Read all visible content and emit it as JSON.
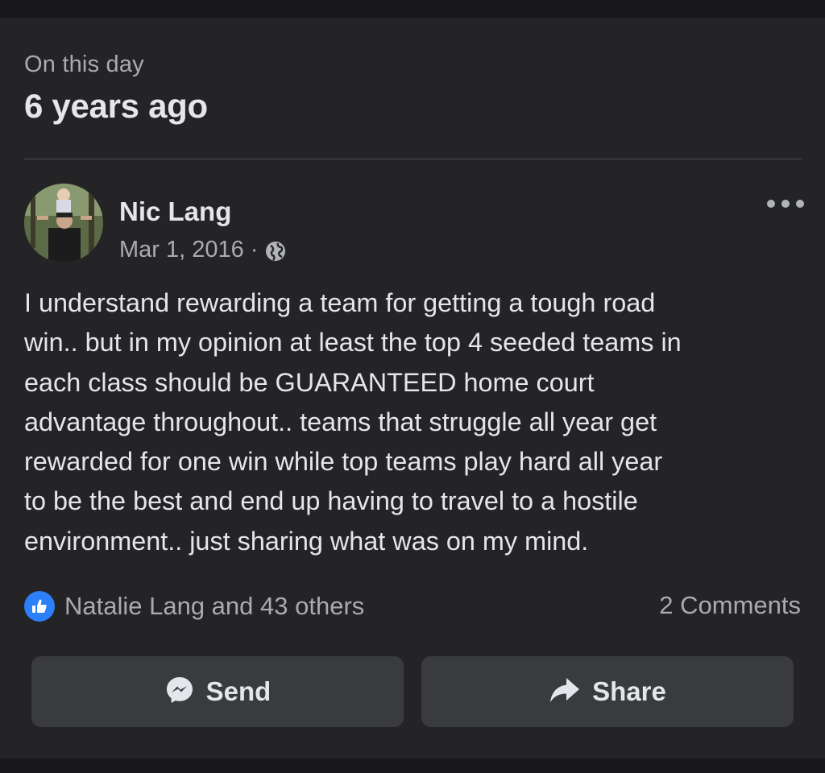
{
  "memory": {
    "label": "On this day",
    "title": "6 years ago"
  },
  "post": {
    "author": "Nic Lang",
    "date": "Mar 1, 2016",
    "separator": "·",
    "audience_icon": "globe-icon",
    "body": "I understand rewarding a team for getting a tough road\nwin.. but in my opinion at least the top 4 seeded teams in\neach class should be GUARANTEED home court\nadvantage throughout.. teams that struggle all year get\nrewarded for one win while top teams play hard all year\nto be the best and end up having to travel to a hostile\nenvironment.. just sharing what was on my mind."
  },
  "engagement": {
    "reaction_icon": "like-icon",
    "reactions_text": "Natalie Lang and 43 others",
    "comments_text": "2 Comments"
  },
  "actions": {
    "send_label": "Send",
    "share_label": "Share"
  },
  "colors": {
    "background": "#18181a",
    "card": "#242426",
    "button": "#3a3b3d",
    "primary_text": "#e4e6eb",
    "secondary_text": "#a9abaf",
    "like_blue": "#2d7ff9"
  }
}
